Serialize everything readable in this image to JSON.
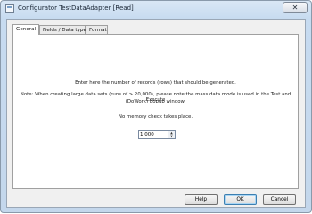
{
  "window": {
    "title": "Configurator TestDataAdapter [Read]",
    "close_glyph": "✕"
  },
  "tabs": [
    {
      "label": "General",
      "active": true
    },
    {
      "label": "Fields / Data types",
      "active": false
    },
    {
      "label": "Format",
      "active": false
    }
  ],
  "general": {
    "instruction": "Enter here the number of records (rows) that should be generated.",
    "note_line1": "Note: When creating large data sets (runs of > 20,000), please note the mass data mode is used in the Test and Execute",
    "note_line2": "(DoWork) popup window.",
    "memory_note": "No memory check takes place.",
    "records_value": "1,000"
  },
  "buttons": {
    "help": "Help",
    "ok": "OK",
    "cancel": "Cancel"
  }
}
